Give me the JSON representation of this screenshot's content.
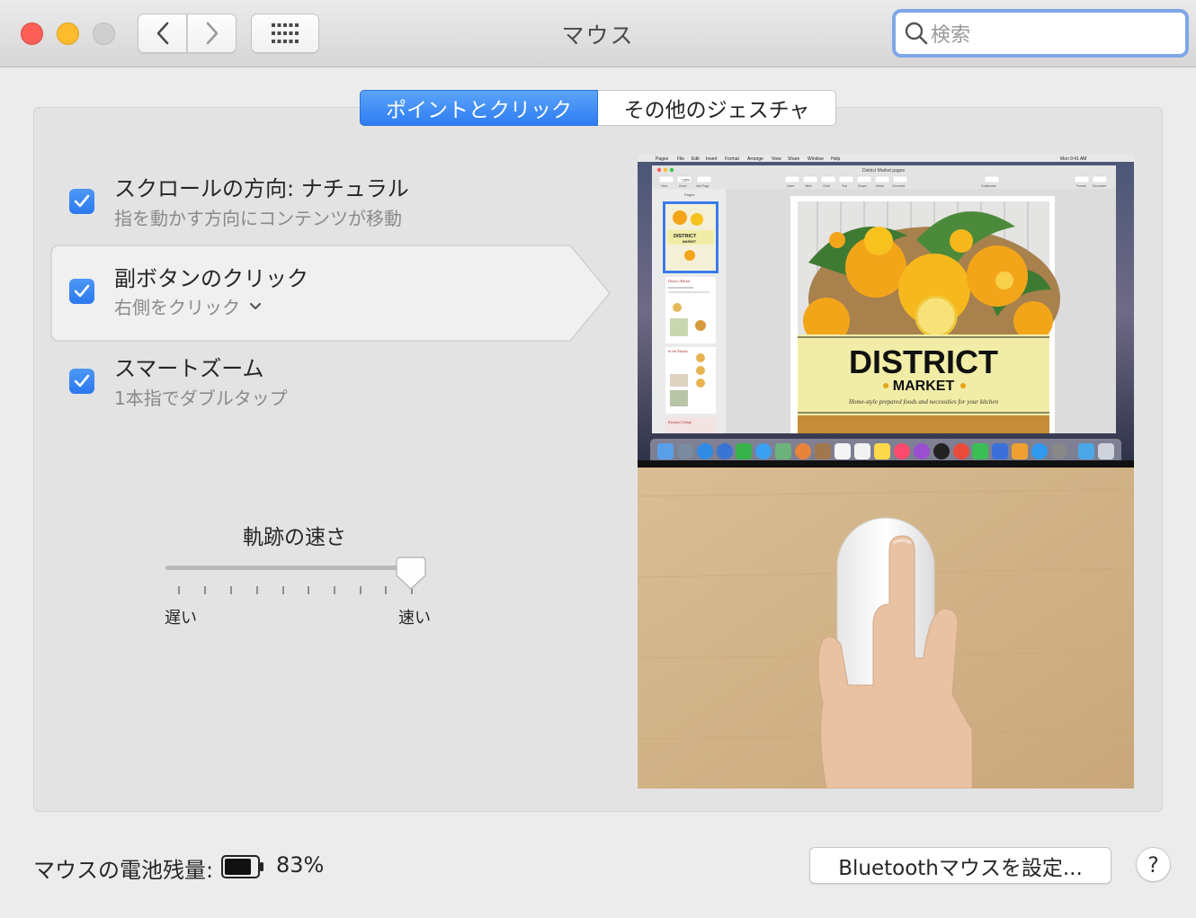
{
  "window": {
    "title": "マウス"
  },
  "search": {
    "placeholder": "検索"
  },
  "tabs": [
    {
      "label": "ポイントとクリック",
      "active": true
    },
    {
      "label": "その他のジェスチャ",
      "active": false
    }
  ],
  "options": [
    {
      "title": "スクロールの方向: ナチュラル",
      "subtitle": "指を動かす方向にコンテンツが移動",
      "checked": true
    },
    {
      "title": "副ボタンのクリック",
      "subtitle": "右側をクリック",
      "checked": true,
      "selected": true
    },
    {
      "title": "スマートズーム",
      "subtitle": "1本指でダブルタップ",
      "checked": true
    }
  ],
  "tracking": {
    "title": "軌跡の速さ",
    "min_label": "遅い",
    "max_label": "速い",
    "value_fraction": 0.93
  },
  "preview": {
    "menubar_items": [
      "Pages",
      "File",
      "Edit",
      "Insert",
      "Format",
      "Arrange",
      "View",
      "Share",
      "Window",
      "Help"
    ],
    "clock": "Mon 9:41 AM",
    "doc_title": "District Market.pages",
    "sidebar_header": "Pages",
    "toolbar_labels": [
      "View",
      "Zoom",
      "Add Page",
      "Insert",
      "Table",
      "Chart",
      "Text",
      "Shape",
      "Media",
      "Comment",
      "Collaborate",
      "Format",
      "Document"
    ],
    "zoom_value": "125%",
    "thumb_titles": [
      "DISTRICT",
      "MARKET",
      "District Market",
      "In the Market",
      "Kitchen College"
    ],
    "banner_title": "DISTRICT",
    "banner_subtitle": "MARKET",
    "banner_tagline": "Home-style prepared foods and necessities for your kitchen"
  },
  "footer": {
    "battery_label": "マウスの電池残量:",
    "battery_percent": "83%",
    "battery_level": 0.83,
    "bluetooth_button": "Bluetoothマウスを設定...",
    "help_button": "?"
  },
  "colors": {
    "accent": "#2f7cf2",
    "close": "#fc5f57",
    "minimize": "#fdbc2e",
    "zoom": "#cfcfcf"
  }
}
